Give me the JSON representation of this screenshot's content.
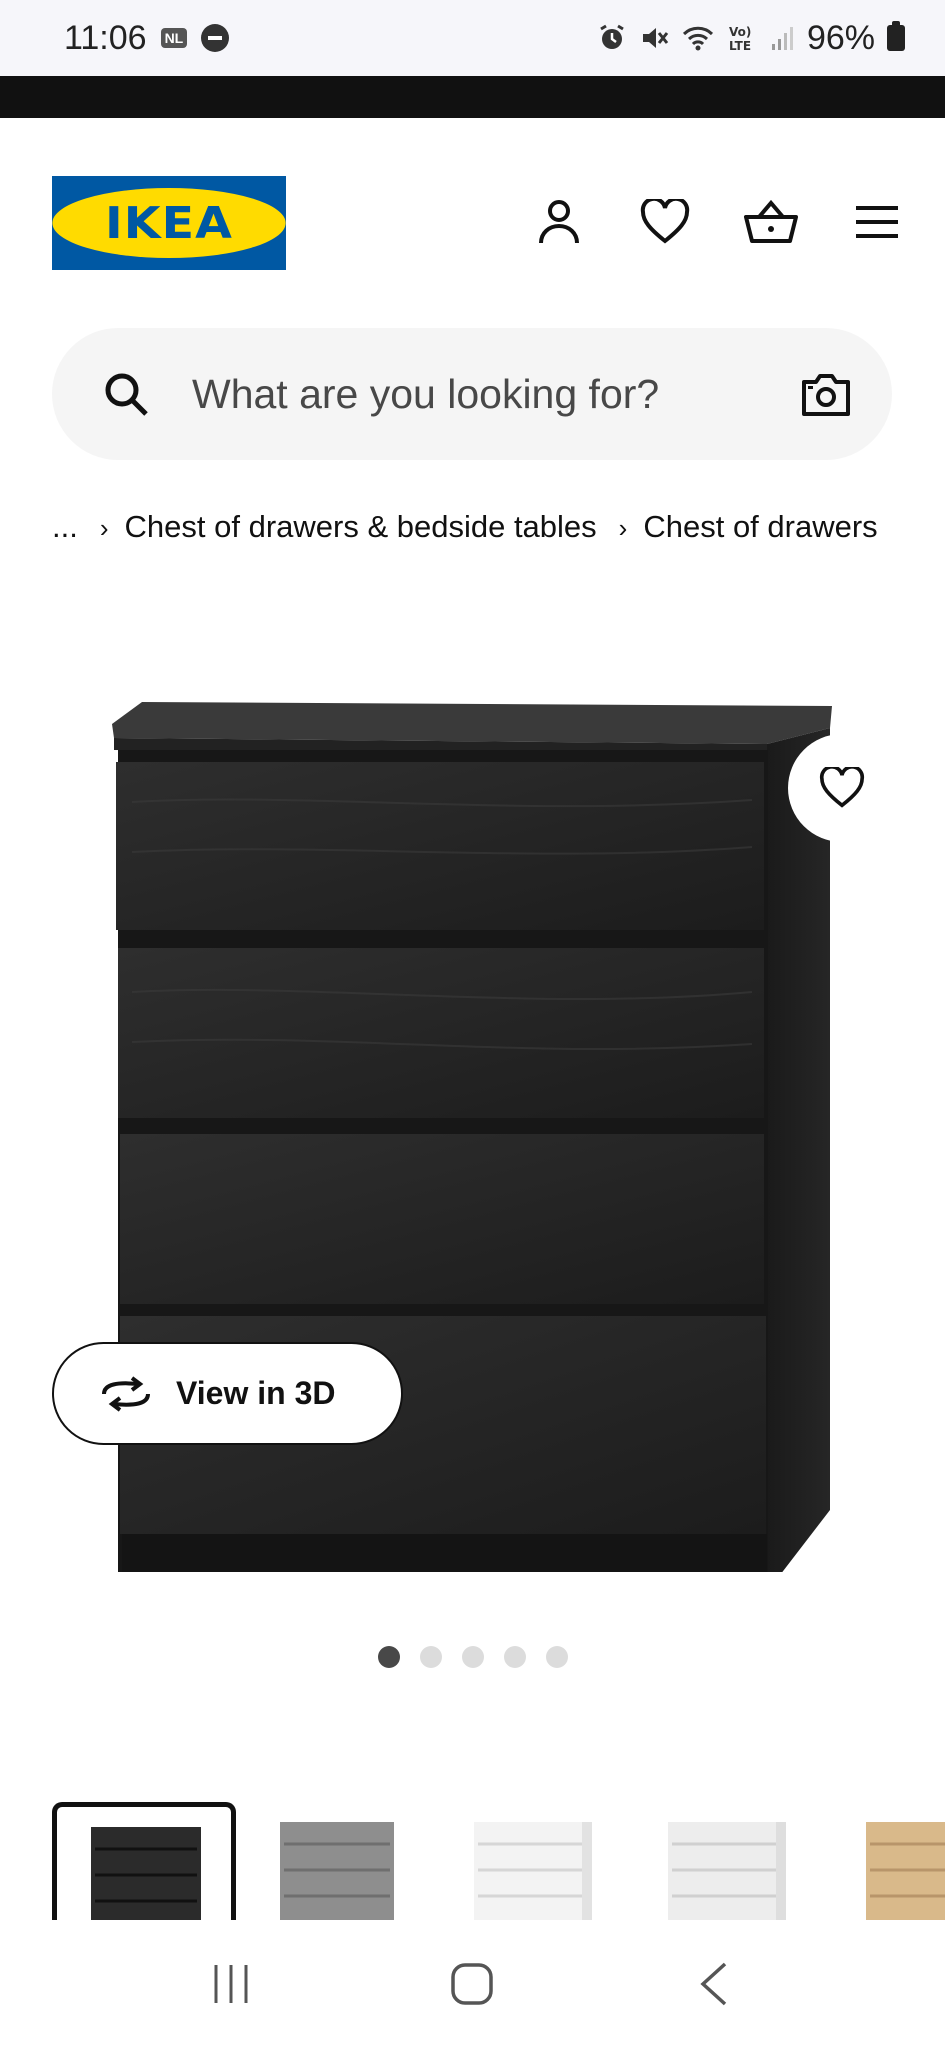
{
  "status_bar": {
    "time": "11:06",
    "badge": "NL",
    "volte": "Vo) LTE",
    "battery": "96%"
  },
  "header": {
    "logo_text": "IKEA",
    "icons": [
      "profile-icon",
      "heart-icon",
      "basket-icon",
      "menu-icon"
    ]
  },
  "search": {
    "placeholder": "What are you looking for?"
  },
  "breadcrumb": {
    "ellipsis": "...",
    "items": [
      "Chest of drawers & bedside tables",
      "Chest of drawers"
    ]
  },
  "product": {
    "view3d_label": "View in 3D",
    "image_count": 5,
    "active_image": 1
  },
  "thumbnails": [
    {
      "color": "#2b2b2b",
      "selected": true
    },
    {
      "color": "#8e8e8e",
      "selected": false
    },
    {
      "color": "#f3f3f3",
      "selected": false
    },
    {
      "color": "#ededed",
      "selected": false
    },
    {
      "color": "#d9b98a",
      "selected": false
    }
  ],
  "colors": {
    "brand_blue": "#0058a3",
    "brand_yellow": "#ffdb00"
  }
}
